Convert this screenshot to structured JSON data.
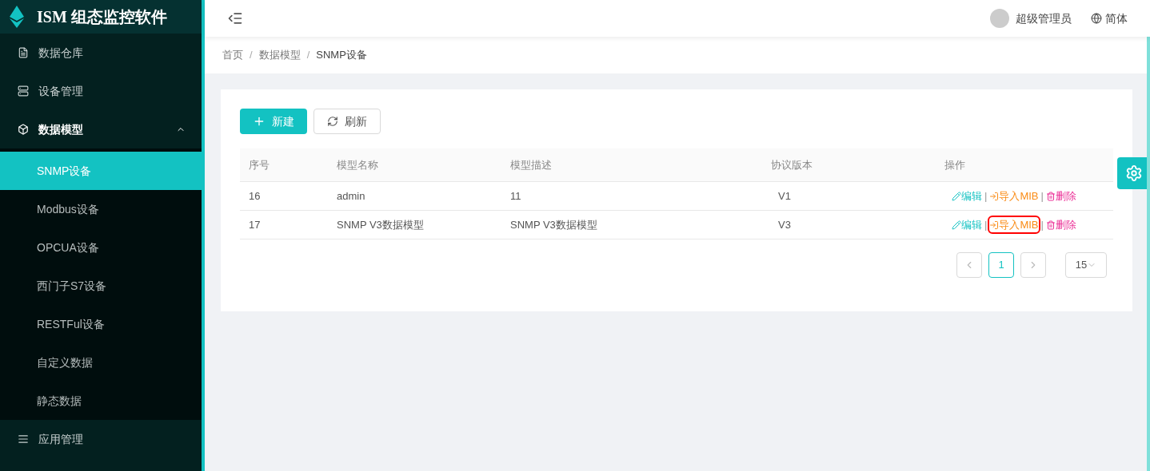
{
  "app": {
    "title": "ISM 组态监控软件"
  },
  "sidebar": {
    "items": [
      {
        "label": "数据仓库",
        "expanded": false
      },
      {
        "label": "设备管理",
        "expanded": false
      },
      {
        "label": "数据模型",
        "expanded": true,
        "children": [
          {
            "label": "SNMP设备",
            "selected": true
          },
          {
            "label": "Modbus设备",
            "selected": false
          },
          {
            "label": "OPCUA设备",
            "selected": false
          },
          {
            "label": "西门子S7设备",
            "selected": false
          },
          {
            "label": "RESTFul设备",
            "selected": false
          },
          {
            "label": "自定义数据",
            "selected": false
          },
          {
            "label": "静态数据",
            "selected": false
          }
        ]
      },
      {
        "label": "应用管理",
        "expanded": false
      }
    ]
  },
  "header": {
    "user": "超级管理员",
    "language": "简体"
  },
  "breadcrumb": [
    {
      "label": "首页"
    },
    {
      "separator": "/",
      "label": "数据模型"
    },
    {
      "separator": "/",
      "label": "SNMP设备"
    }
  ],
  "toolbar": [
    {
      "kind": "primary",
      "label": "新建"
    },
    {
      "kind": "default",
      "label": "刷新"
    }
  ],
  "table": {
    "columns": [
      "序号",
      "模型名称",
      "模型描述",
      "协议版本",
      "操作"
    ],
    "rows": [
      {
        "cells": [
          "16",
          "admin",
          "11",
          "V1"
        ],
        "actions": [
          {
            "kind": "edit",
            "label": "编辑",
            "highlighted": false
          },
          {
            "kind": "import",
            "separator": "|",
            "label": "导入MIB",
            "highlighted": false
          },
          {
            "kind": "delete",
            "separator": "|",
            "label": "删除",
            "highlighted": false
          }
        ]
      },
      {
        "cells": [
          "17",
          "SNMP V3数据模型",
          "SNMP V3数据模型",
          "V3"
        ],
        "actions": [
          {
            "kind": "edit",
            "label": "编辑",
            "highlighted": false
          },
          {
            "kind": "import",
            "separator": "|",
            "label": "导入MIB",
            "highlighted": true
          },
          {
            "kind": "delete",
            "separator": "|",
            "label": "删除",
            "highlighted": false
          }
        ]
      }
    ]
  },
  "pagination": {
    "pages": [
      {
        "label": "1",
        "selected": true
      }
    ],
    "page_size": "15"
  }
}
